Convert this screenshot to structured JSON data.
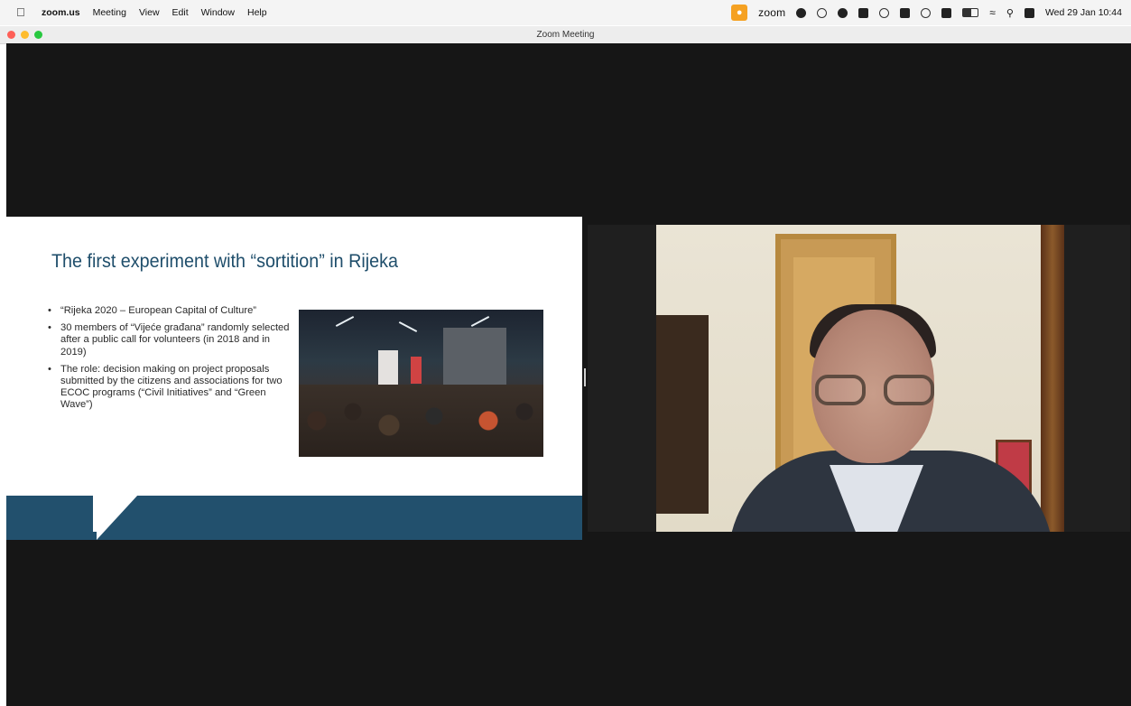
{
  "menubar": {
    "app_name": "zoom.us",
    "items": [
      "Meeting",
      "View",
      "Edit",
      "Window",
      "Help"
    ],
    "status_app_label": "zoom",
    "clock": "Wed 29 Jan  10:44",
    "mic_accent_color": "#f5a122"
  },
  "window": {
    "title": "Zoom Meeting"
  },
  "slide": {
    "title": "The first experiment with “sortition” in Rijeka",
    "bullets": [
      "“Rijeka 2020 – European Capital of Culture”",
      "30 members of “Vijeće građana” randomly selected after a public call for volunteers (in 2018 and in 2019)",
      "The role: decision making on project proposals submitted by the citizens and associations for two ECOC programs (“Civil Initiatives” and “Green Wave”)"
    ],
    "accent_color": "#22506d"
  }
}
